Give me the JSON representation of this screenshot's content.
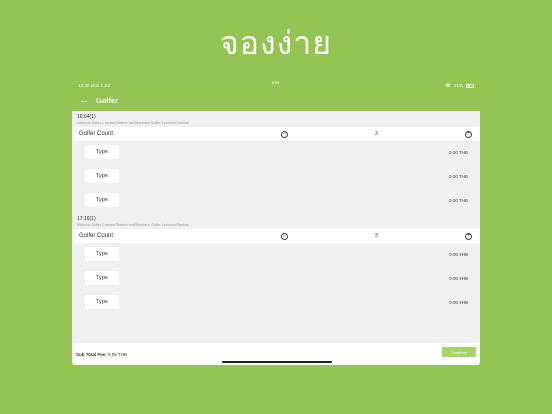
{
  "hero": {
    "title": "จองง่าย"
  },
  "status": {
    "time": "13:30",
    "date": "Mon 1 Jul",
    "dots": "•••",
    "battery": "31%"
  },
  "nav": {
    "back": "←",
    "title": "Golfer"
  },
  "sections": [
    {
      "time": "16:04(1)",
      "note": "Minimum Golfer 1 person/Teetime and Maximum Golfer 4 persons/Teetime",
      "count_label": "Golfer Count",
      "count_value": "3",
      "types": [
        {
          "label": "Type",
          "fee": "0.00 THB"
        },
        {
          "label": "Type",
          "fee": "0.00 THB"
        },
        {
          "label": "Type",
          "fee": "0.00 THB"
        }
      ]
    },
    {
      "time": "17:16(1)",
      "note": "Minimum Golfer 1 person/Teetime and Maximum Golfer 4 persons/Teetime",
      "count_label": "Golfer Count",
      "count_value": "3",
      "types": [
        {
          "label": "Type",
          "fee": "0.00 THB"
        },
        {
          "label": "Type",
          "fee": "0.00 THB"
        },
        {
          "label": "Type",
          "fee": "0.00 THB"
        }
      ]
    }
  ],
  "footer": {
    "subtotal_label": "Sub Total Fee:",
    "subtotal_value": "0.00 THB",
    "continue_label": "Continue"
  },
  "icons": {
    "minus": "minus-circle-icon",
    "plus": "plus-circle-icon",
    "back": "arrow-left-icon",
    "wifi": "wifi-icon",
    "battery": "battery-icon"
  },
  "colors": {
    "brand_green": "#94c454",
    "button_green": "#a8d36a"
  }
}
